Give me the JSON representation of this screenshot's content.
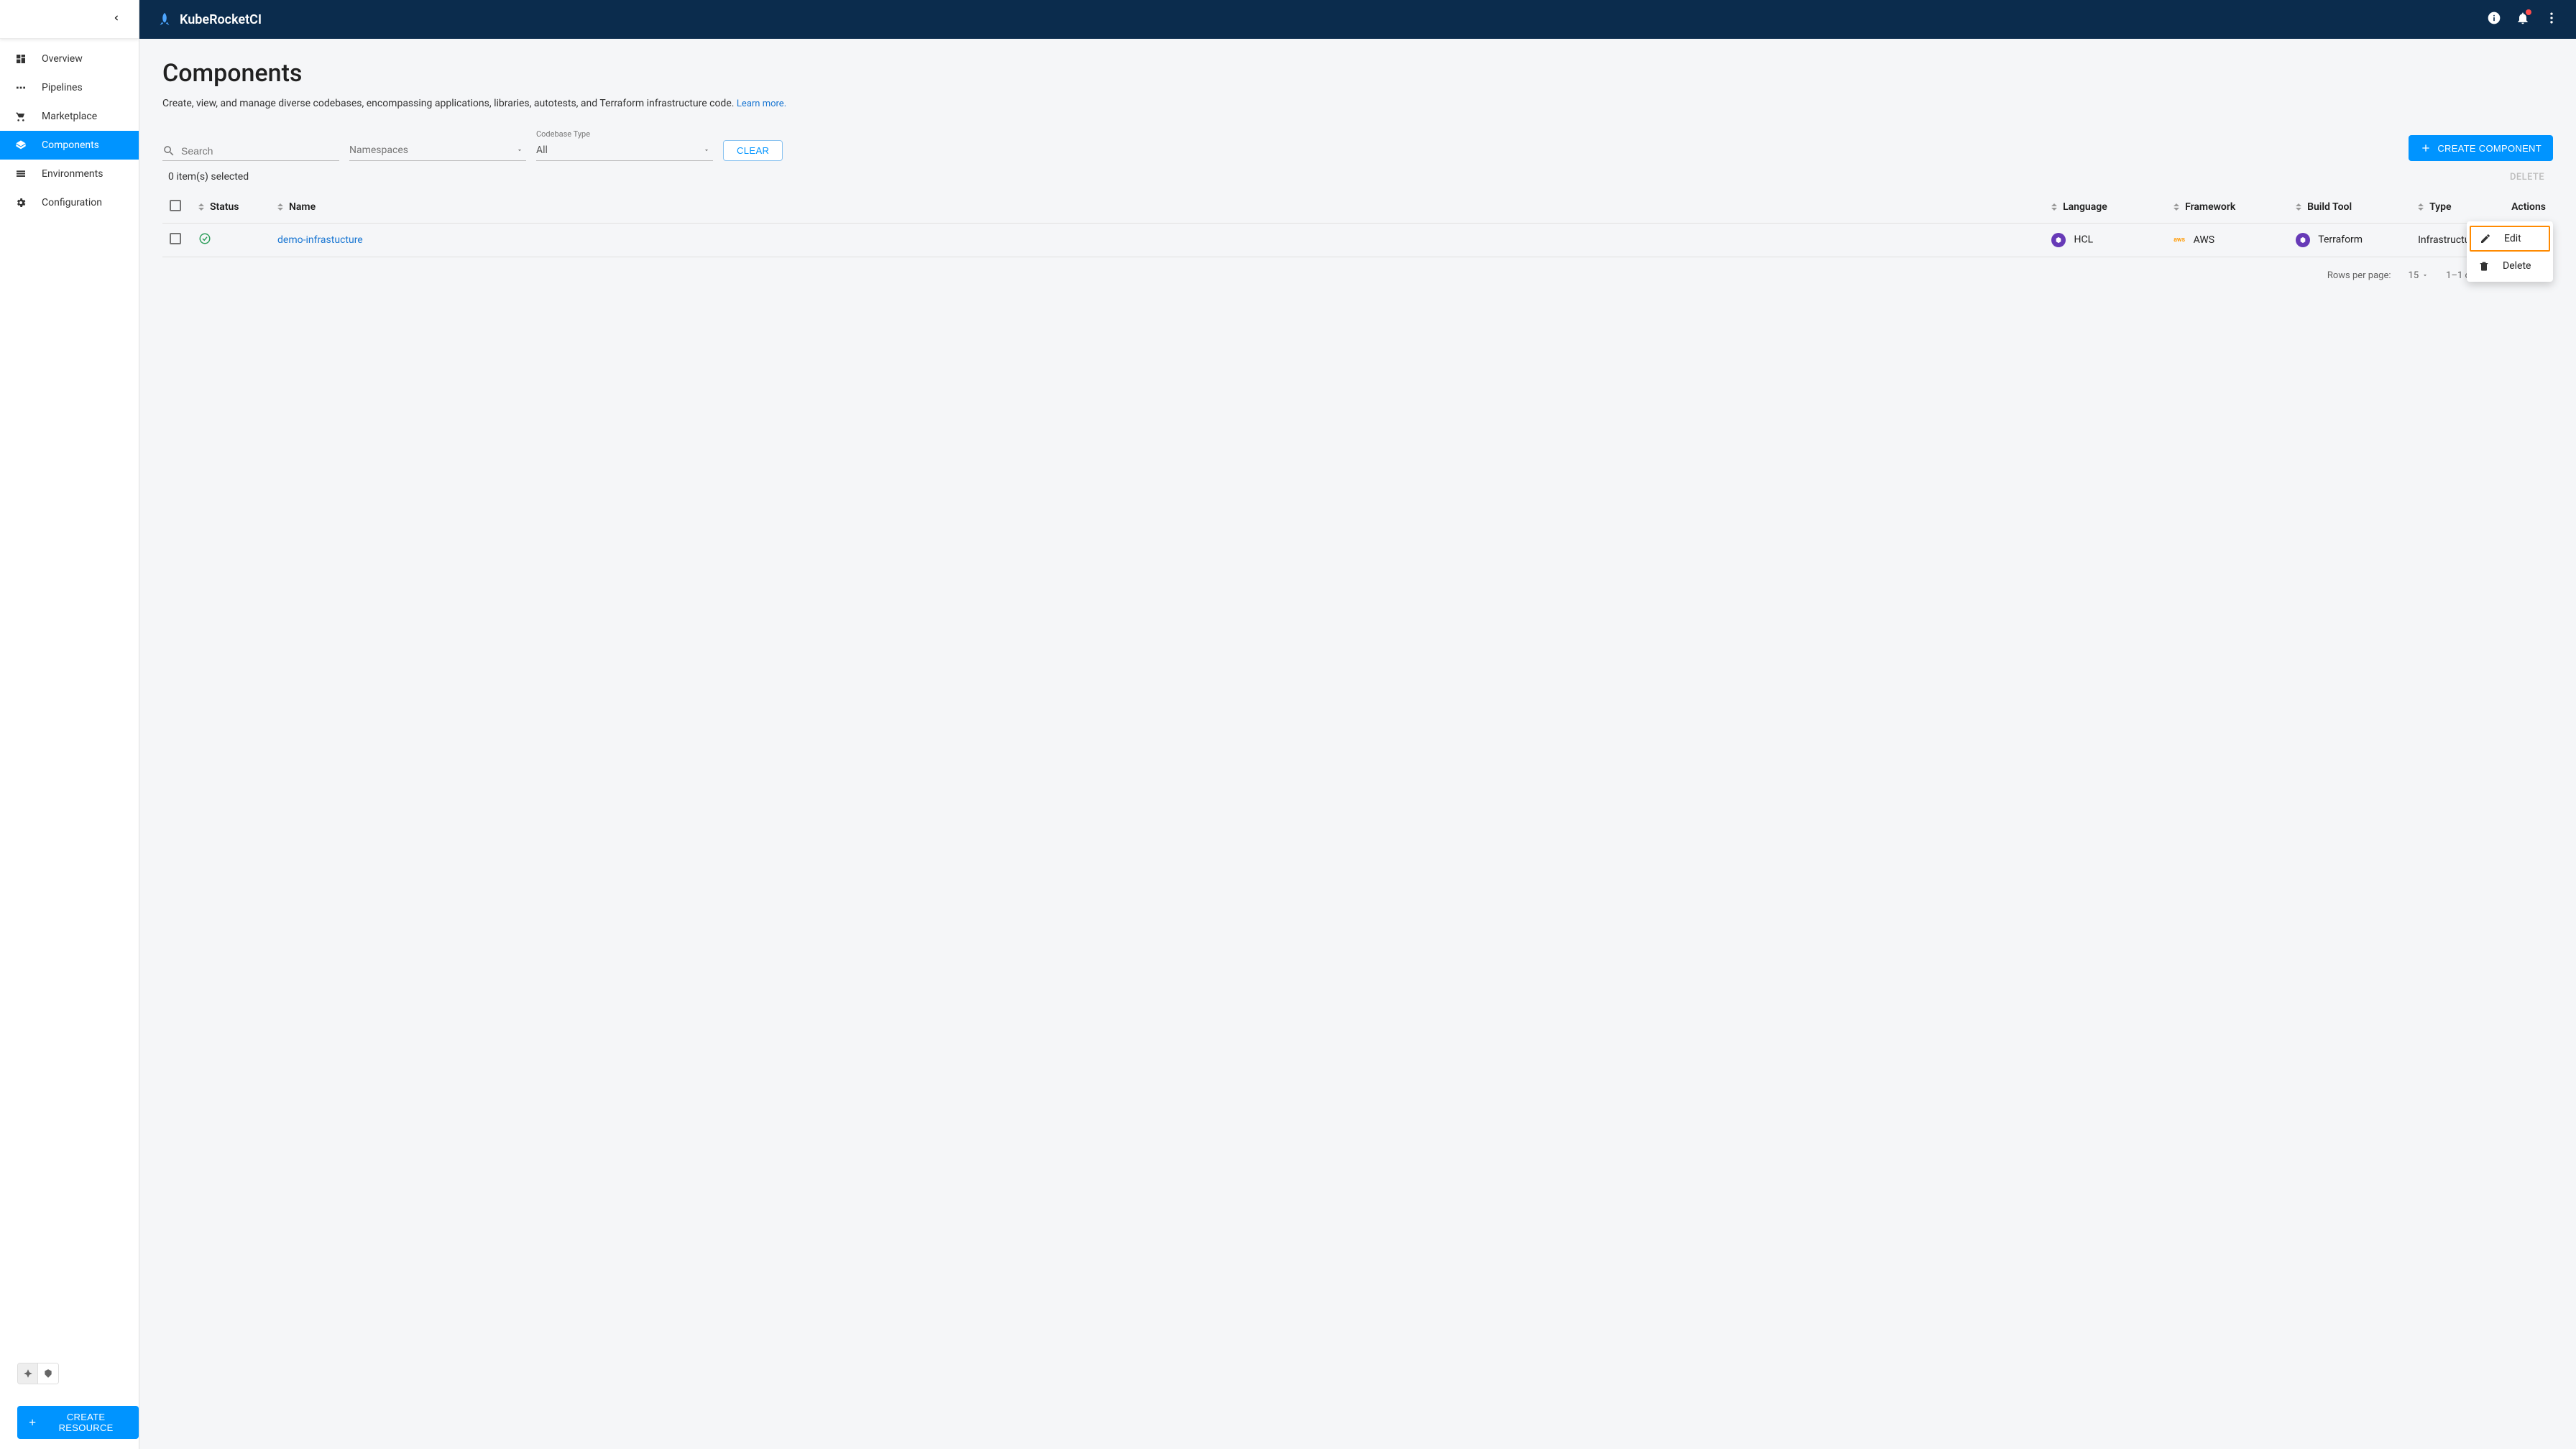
{
  "brand": "KubeRocketCI",
  "sidebar": {
    "items": [
      {
        "label": "Overview"
      },
      {
        "label": "Pipelines"
      },
      {
        "label": "Marketplace"
      },
      {
        "label": "Components"
      },
      {
        "label": "Environments"
      },
      {
        "label": "Configuration"
      }
    ],
    "create_resource": "CREATE RESOURCE"
  },
  "page": {
    "title": "Components",
    "description": "Create, view, and manage diverse codebases, encompassing applications, libraries, autotests, and Terraform infrastructure code. ",
    "learn_more": "Learn more."
  },
  "filters": {
    "search_placeholder": "Search",
    "namespaces_placeholder": "Namespaces",
    "codebase_type_label": "Codebase Type",
    "codebase_type_value": "All",
    "clear": "CLEAR",
    "create_component": "CREATE COMPONENT"
  },
  "selection": {
    "text": "0 item(s) selected",
    "delete": "DELETE"
  },
  "table": {
    "columns": {
      "status": "Status",
      "name": "Name",
      "language": "Language",
      "framework": "Framework",
      "build_tool": "Build Tool",
      "type": "Type",
      "actions": "Actions"
    },
    "rows": [
      {
        "name": "demo-infrastucture",
        "language": "HCL",
        "framework": "AWS",
        "build_tool": "Terraform",
        "type": "Infrastructure"
      }
    ]
  },
  "pagination": {
    "rows_per_page_label": "Rows per page:",
    "rows_per_page_value": "15",
    "range": "1–1 of 1"
  },
  "context_menu": {
    "edit": "Edit",
    "delete": "Delete"
  }
}
